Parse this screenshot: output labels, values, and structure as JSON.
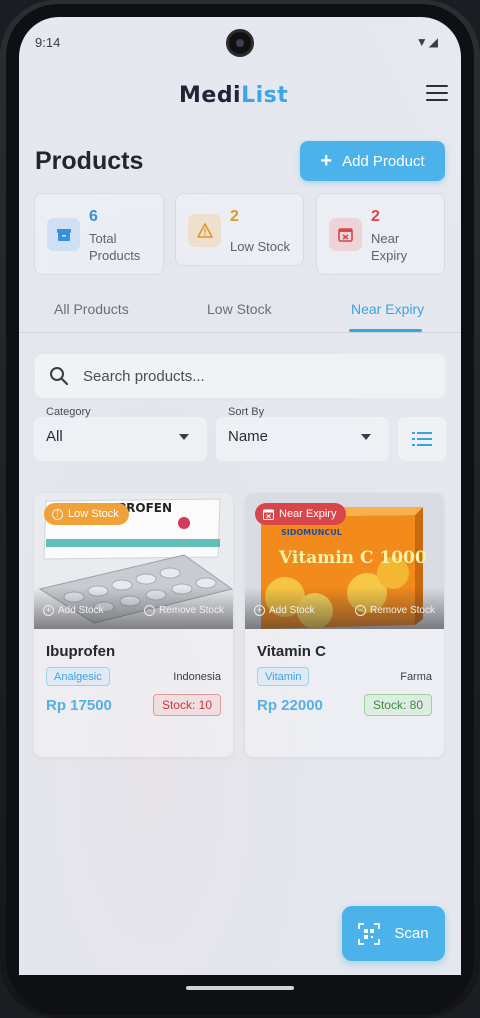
{
  "status_bar": {
    "time": "9:14"
  },
  "header": {
    "logo_part1": "Medi",
    "logo_part2": "List",
    "menu_icon": "hamburger-icon"
  },
  "page": {
    "title": "Products",
    "add_button_label": "Add Product"
  },
  "stats": [
    {
      "value": "6",
      "label_line1": "Total",
      "label_line2": "Products",
      "color": "#3a8fd9",
      "icon": "archive-icon"
    },
    {
      "value": "2",
      "label_line1": "Low Stock",
      "label_line2": "",
      "color": "#e3962b",
      "icon": "warning-icon"
    },
    {
      "value": "2",
      "label_line1": "Near",
      "label_line2": "Expiry",
      "color": "#d9464a",
      "icon": "calendar-x-icon"
    }
  ],
  "tabs": [
    {
      "label": "All Products",
      "active": false
    },
    {
      "label": "Low Stock",
      "active": false
    },
    {
      "label": "Near Expiry",
      "active": true
    }
  ],
  "search": {
    "placeholder": "Search products..."
  },
  "filters": {
    "category": {
      "caption": "Category",
      "value": "All"
    },
    "sort": {
      "caption": "Sort By",
      "value": "Name"
    }
  },
  "products": [
    {
      "name": "Ibuprofen",
      "badge": "Low Stock",
      "badge_color": "#f0a238",
      "category": "Analgesic",
      "origin": "Indonesia",
      "price": "Rp 17500",
      "stock": "Stock: 10",
      "stock_state": "low",
      "package_text": "IBUPROFEN",
      "add_stock_label": "Add Stock",
      "remove_stock_label": "Remove Stock"
    },
    {
      "name": "Vitamin C",
      "badge": "Near Expiry",
      "badge_color": "#d9464a",
      "category": "Vitamin",
      "origin": "Farma",
      "price": "Rp 22000",
      "stock": "Stock: 80",
      "stock_state": "ok",
      "package_brand": "SIDOMUNCUL",
      "package_text": "Vitamin C 1000",
      "add_stock_label": "Add Stock",
      "remove_stock_label": "Remove Stock"
    }
  ],
  "scan_button": {
    "label": "Scan"
  },
  "colors": {
    "accent": "#4bb3ea",
    "danger": "#d9464a",
    "warning": "#e3962b"
  }
}
